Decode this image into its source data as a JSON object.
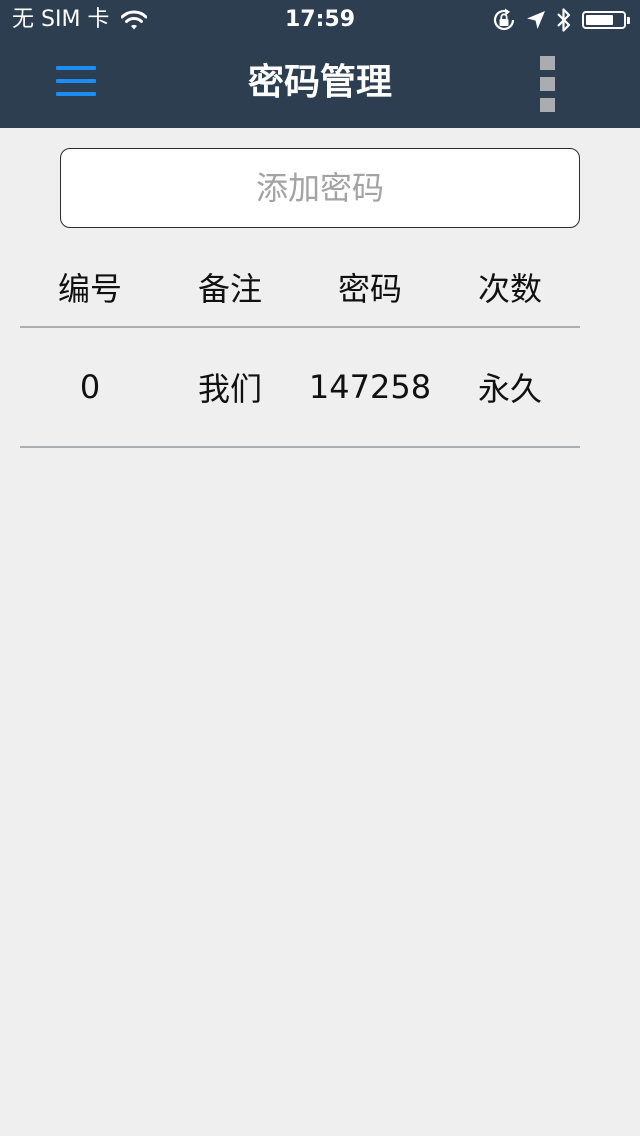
{
  "status_bar": {
    "carrier": "无 SIM 卡",
    "time": "17:59",
    "battery_level": 0.75,
    "icons": [
      "wifi-icon",
      "rotation-lock-icon",
      "location-icon",
      "bluetooth-icon",
      "battery-icon"
    ]
  },
  "navbar": {
    "title": "密码管理",
    "menu_icon": "hamburger-menu-icon",
    "more_icon": "more-vertical-icon"
  },
  "add_button": {
    "label": "添加密码"
  },
  "table": {
    "headers": [
      "编号",
      "备注",
      "密码",
      "次数"
    ],
    "rows": [
      [
        "0",
        "我们",
        "147258",
        "永久"
      ]
    ]
  },
  "colors": {
    "navbar_bg": "#2c3e50",
    "accent_blue": "#1b8cf2",
    "page_bg": "#efefef",
    "divider": "#a8b0b5"
  }
}
